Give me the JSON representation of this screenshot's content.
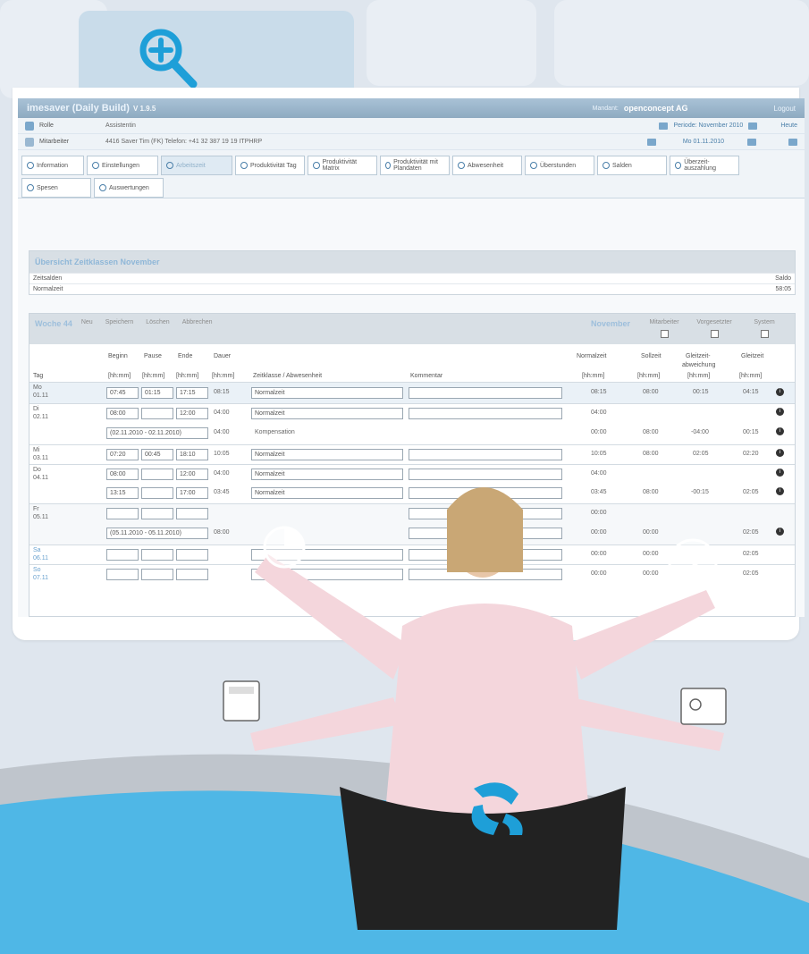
{
  "titlebar": {
    "app_name": "imesaver (Daily Build)",
    "version": "V 1.9.5",
    "mandant_label": "Mandant:",
    "mandant": "openconcept AG",
    "logout": "Logout"
  },
  "info_rows": [
    {
      "label": "Rolle",
      "value": "Assistentin",
      "period": "Periode: November 2010",
      "link": "Heute"
    },
    {
      "label": "Mitarbeiter",
      "value": "4416 Saver Tim  (FK)  Telefon: +41 32 387 19 19  ITPHRP",
      "period": "Mo 01.11.2010"
    }
  ],
  "tabs": [
    "Information",
    "Einstellungen",
    "Arbeitszeit",
    "Produktivität Tag",
    "Produktivität Matrix",
    "Produktivität mit Plandaten",
    "Abwesenheit",
    "Überstunden",
    "Salden",
    "Überzeit-auszahlung",
    "Spesen",
    "Auswertungen"
  ],
  "overview": {
    "title": "Übersicht Zeitklassen November",
    "col_left": "Zeitsalden",
    "col_right": "Saldo",
    "row_label": "Normalzeit",
    "row_value": "58:05"
  },
  "week": {
    "title": "Woche 44",
    "new": "Neu",
    "save": "Speichern",
    "delete": "Löschen",
    "cancel": "Abbrechen",
    "month": "November",
    "checks": [
      "Mitarbeiter",
      "Vorgesetzter",
      "System"
    ]
  },
  "columns": {
    "tag": "Tag",
    "beginn": "Beginn",
    "pause": "Pause",
    "ende": "Ende",
    "dauer": "Dauer",
    "unit": "[hh:mm]",
    "zeitklasse": "Zeitklasse / Abwesenheit",
    "kommentar": "Kommentar",
    "normalzeit": "Normalzeit",
    "sollzeit": "Sollzeit",
    "gleitzeit_abw_1": "Gleitzeit-",
    "gleitzeit_abw_2": "abweichung",
    "gleitzeit": "Gleitzeit"
  },
  "rows": [
    {
      "day": "Mo",
      "date": "01.11",
      "beginn": "07:45",
      "pause": "01:15",
      "ende": "17:15",
      "dauer": "08:15",
      "klasse": "Normalzeit",
      "normal": "08:15",
      "soll": "08:00",
      "abw": "00:15",
      "gleit": "04:15"
    },
    {
      "day": "Di",
      "date": "02.11",
      "beginn": "08:00",
      "pause": "",
      "ende": "12:00",
      "dauer": "04:00",
      "klasse": "Normalzeit",
      "normal": "04:00",
      "soll": "",
      "abw": "",
      "gleit": ""
    },
    {
      "range": "(02.11.2010 - 02.11.2010)",
      "dauer": "04:00",
      "klasse": "Kompensation",
      "normal": "00:00",
      "soll": "08:00",
      "abw": "-04:00",
      "gleit": "00:15"
    },
    {
      "day": "Mi",
      "date": "03.11",
      "beginn": "07:20",
      "pause": "00:45",
      "ende": "18:10",
      "dauer": "10:05",
      "klasse": "Normalzeit",
      "normal": "10:05",
      "soll": "08:00",
      "abw": "02:05",
      "gleit": "02:20"
    },
    {
      "day": "Do",
      "date": "04.11",
      "beginn": "08:00",
      "pause": "",
      "ende": "12:00",
      "dauer": "04:00",
      "klasse": "Normalzeit",
      "normal": "04:00",
      "soll": "",
      "abw": "",
      "gleit": ""
    },
    {
      "beginn": "13:15",
      "pause": "",
      "ende": "17:00",
      "dauer": "03:45",
      "klasse": "Normalzeit",
      "normal": "03:45",
      "soll": "08:00",
      "abw": "-00:15",
      "gleit": "02:05"
    },
    {
      "day": "Fr",
      "date": "05.11",
      "normal": "00:00"
    },
    {
      "range": "(05.11.2010 - 05.11.2010)",
      "dauer": "08:00",
      "normal": "00:00",
      "soll": "00:00",
      "gleit": "02:05"
    },
    {
      "day": "Sa",
      "date": "06.11",
      "normal": "00:00",
      "soll": "00:00",
      "gleit": "02:05"
    },
    {
      "day": "So",
      "date": "07.11",
      "normal": "00:00",
      "soll": "00:00",
      "gleit": "02:05"
    }
  ],
  "colors": {
    "accent": "#1e9fd8",
    "tab_bg": "#c9dcea",
    "title_bar": "#8eaac1"
  },
  "icons": [
    "zoom-in-icon",
    "pie-chart-icon",
    "clock-icon",
    "calculator-icon",
    "id-card-icon",
    "logo-icon"
  ]
}
